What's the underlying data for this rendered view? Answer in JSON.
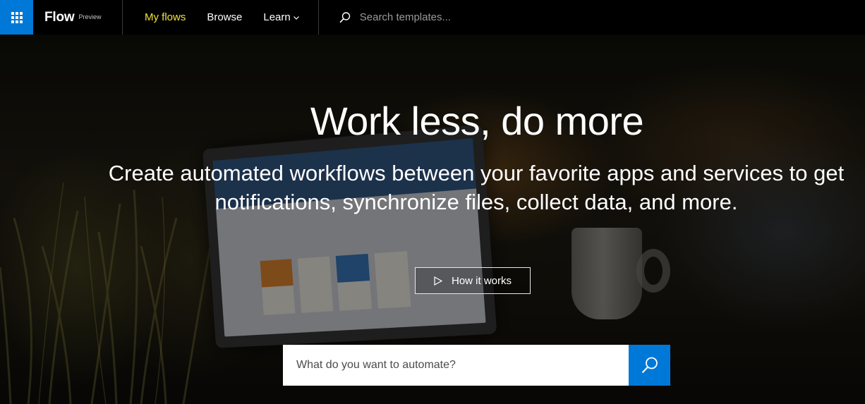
{
  "nav": {
    "brand": "Flow",
    "brand_tag": "Preview",
    "items": [
      {
        "label": "My flows",
        "active": true
      },
      {
        "label": "Browse",
        "active": false
      },
      {
        "label": "Learn",
        "active": false
      }
    ],
    "search_placeholder": "Search templates..."
  },
  "hero": {
    "title": "Work less, do more",
    "subtitle": "Create automated workflows between your favorite apps and services to get notifications, synchronize files, collect data, and more.",
    "how_it_works": "How it works",
    "search_placeholder": "What do you want to automate?"
  },
  "colors": {
    "accent": "#0078d7",
    "active_nav": "#f4e23b",
    "background": "#000000"
  },
  "icons": {
    "waffle": "app-launcher-icon",
    "search": "search-icon",
    "chevron": "chevron-down-icon",
    "play": "play-icon"
  }
}
